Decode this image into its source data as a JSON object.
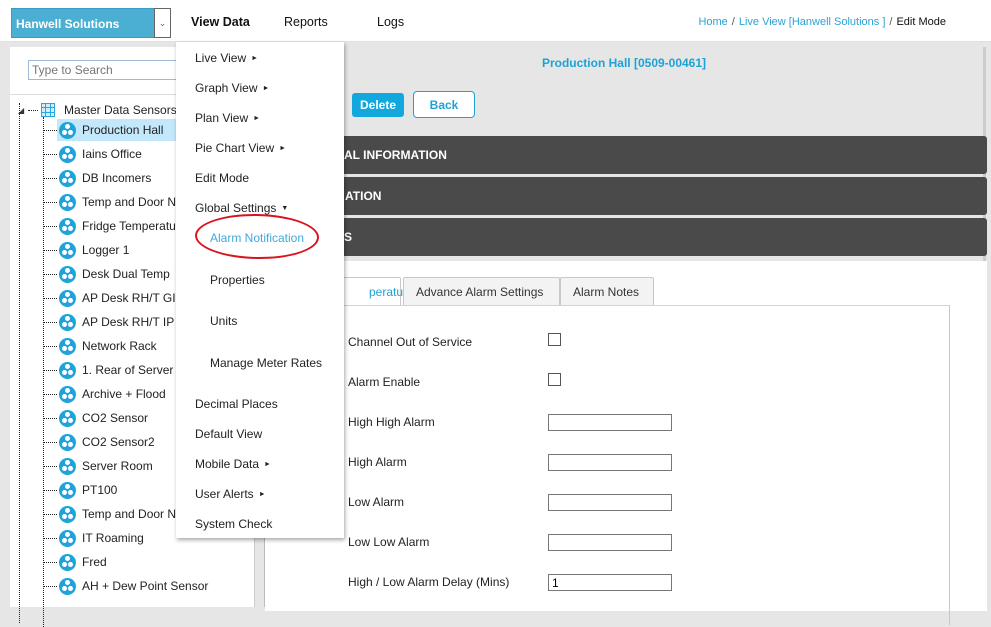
{
  "header": {
    "company": "Hanwell Solutions",
    "nav": [
      "View Data",
      "Reports",
      "Logs"
    ],
    "breadcrumb": {
      "home": "Home",
      "live_view": "Live View [Hanwell Solutions ]",
      "current": "Edit Mode",
      "separator": "/"
    }
  },
  "sidebar": {
    "search_placeholder": "Type to Search",
    "root": "Master Data Sensors",
    "nodes": [
      "Production Hall",
      "Iains Office",
      "DB Incomers",
      "Temp and Door N",
      "Fridge Temperatu",
      "Logger 1",
      "Desk Dual Temp",
      "AP Desk RH/T GI",
      "AP Desk RH/T IP",
      "Network Rack",
      "1. Rear of Server",
      "Archive + Flood",
      "CO2 Sensor",
      "CO2 Sensor2",
      "Server Room",
      "PT100",
      "Temp and Door N",
      "IT Roaming",
      "Fred",
      "AH + Dew Point Sensor"
    ],
    "selected_index": 0
  },
  "menu": {
    "items": [
      {
        "label": "Live View",
        "arrow": "►"
      },
      {
        "label": "Graph View",
        "arrow": "►"
      },
      {
        "label": "Plan View",
        "arrow": "►"
      },
      {
        "label": "Pie Chart View",
        "arrow": "►"
      },
      {
        "label": "Edit Mode",
        "arrow": ""
      },
      {
        "label": "Global Settings",
        "arrow": "▼"
      },
      {
        "label": "Alarm Notification",
        "arrow": ""
      },
      {
        "label": "Properties",
        "arrow": ""
      },
      {
        "label": "Units",
        "arrow": ""
      },
      {
        "label": "Manage Meter Rates",
        "arrow": ""
      },
      {
        "label": "Decimal Places",
        "arrow": ""
      },
      {
        "label": "Default View",
        "arrow": ""
      },
      {
        "label": "Mobile Data",
        "arrow": "►"
      },
      {
        "label": "User Alerts",
        "arrow": "►"
      },
      {
        "label": "System Check",
        "arrow": ""
      }
    ]
  },
  "main": {
    "title": "Production Hall [0509-00461]",
    "delete_label": "Delete",
    "back_label": "Back",
    "accordions": [
      "GENERAL INFORMATION",
      "CALIBRATION",
      "ALARMS"
    ],
    "accordion_visible": [
      "AL INFORMATION",
      "ATION",
      "S"
    ],
    "tabs": [
      {
        "label": "Temperature",
        "visible": "perature",
        "active": true
      },
      {
        "label": "Advance Alarm Settings",
        "active": false
      },
      {
        "label": "Alarm Notes",
        "active": false
      }
    ],
    "fields": {
      "channel_out_of_service": {
        "label": "Channel Out of Service",
        "checked": false
      },
      "alarm_enable": {
        "label": "Alarm Enable",
        "checked": false
      },
      "high_high_alarm": {
        "label": "High High Alarm",
        "value": ""
      },
      "high_alarm": {
        "label": "High Alarm",
        "value": ""
      },
      "low_alarm": {
        "label": "Low Alarm",
        "value": ""
      },
      "low_low_alarm": {
        "label": "Low Low Alarm",
        "value": ""
      },
      "alarm_delay": {
        "label": "High / Low Alarm Delay (Mins)",
        "value": "1"
      }
    }
  },
  "colors": {
    "accent": "#1ea2d5",
    "company_bg": "#4bafd4",
    "accordion_bg": "#4a4a4a",
    "annotation": "#d8141d"
  }
}
